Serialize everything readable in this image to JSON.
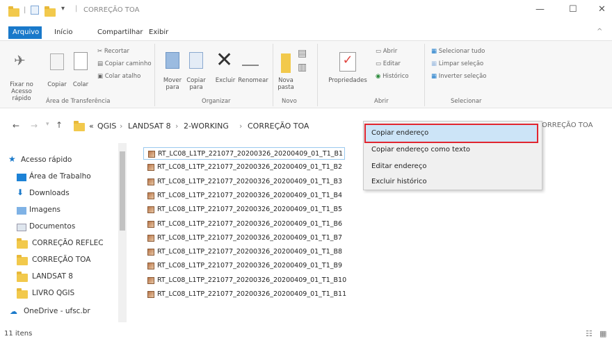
{
  "window": {
    "title": "CORREÇÃO TOA",
    "minimize": "—",
    "maximize": "☐",
    "close": "✕"
  },
  "ribbon_tabs": [
    "Arquivo",
    "Início",
    "Compartilhar",
    "Exibir"
  ],
  "ribbon": {
    "pin_label": "Fixar no Acesso rápido",
    "copy_label": "Copiar",
    "paste_label": "Colar",
    "cut": "Recortar",
    "copy_path": "Copiar caminho",
    "paste_shortcut": "Colar atalho",
    "group_clipboard": "Área de Transferência",
    "move_to": "Mover para",
    "copy_to": "Copiar para",
    "delete": "Excluir",
    "rename": "Renomear",
    "group_organize": "Organizar",
    "new_folder": "Nova pasta",
    "group_new": "Novo",
    "properties": "Propriedades",
    "open": "Abrir",
    "edit": "Editar",
    "history": "Histórico",
    "group_open": "Abrir",
    "select_all": "Selecionar tudo",
    "clear_selection": "Limpar seleção",
    "invert_selection": "Inverter seleção",
    "group_select": "Selecionar"
  },
  "address": {
    "crumbs": [
      "QGIS",
      "LANDSAT 8",
      "2-WORKING",
      "CORREÇÃO TOA"
    ],
    "search_text": "CORREÇÃO TOA"
  },
  "nav": {
    "quick_access": "Acesso rápido",
    "items": [
      "Área de Trabalho",
      "Downloads",
      "Imagens",
      "Documentos",
      "CORREÇÃO REFLEC",
      "CORREÇÃO TOA",
      "LANDSAT 8",
      "LIVRO QGIS"
    ],
    "onedrive": "OneDrive - ufsc.br"
  },
  "files": [
    "RT_LC08_L1TP_221077_20200326_20200409_01_T1_B1",
    "RT_LC08_L1TP_221077_20200326_20200409_01_T1_B2",
    "RT_LC08_L1TP_221077_20200326_20200409_01_T1_B3",
    "RT_LC08_L1TP_221077_20200326_20200409_01_T1_B4",
    "RT_LC08_L1TP_221077_20200326_20200409_01_T1_B5",
    "RT_LC08_L1TP_221077_20200326_20200409_01_T1_B6",
    "RT_LC08_L1TP_221077_20200326_20200409_01_T1_B7",
    "RT_LC08_L1TP_221077_20200326_20200409_01_T1_B8",
    "RT_LC08_L1TP_221077_20200326_20200409_01_T1_B9",
    "RT_LC08_L1TP_221077_20200326_20200409_01_T1_B10",
    "RT_LC08_L1TP_221077_20200326_20200409_01_T1_B11"
  ],
  "context_menu": [
    "Copiar endereço",
    "Copiar endereço como texto",
    "Editar endereço",
    "Excluir histórico"
  ],
  "status": {
    "count": "11 itens"
  },
  "colors": {
    "accent": "#1979ca",
    "highlight": "#cce4f7",
    "red_box": "#e1252f",
    "folder": "#f2c94c"
  }
}
